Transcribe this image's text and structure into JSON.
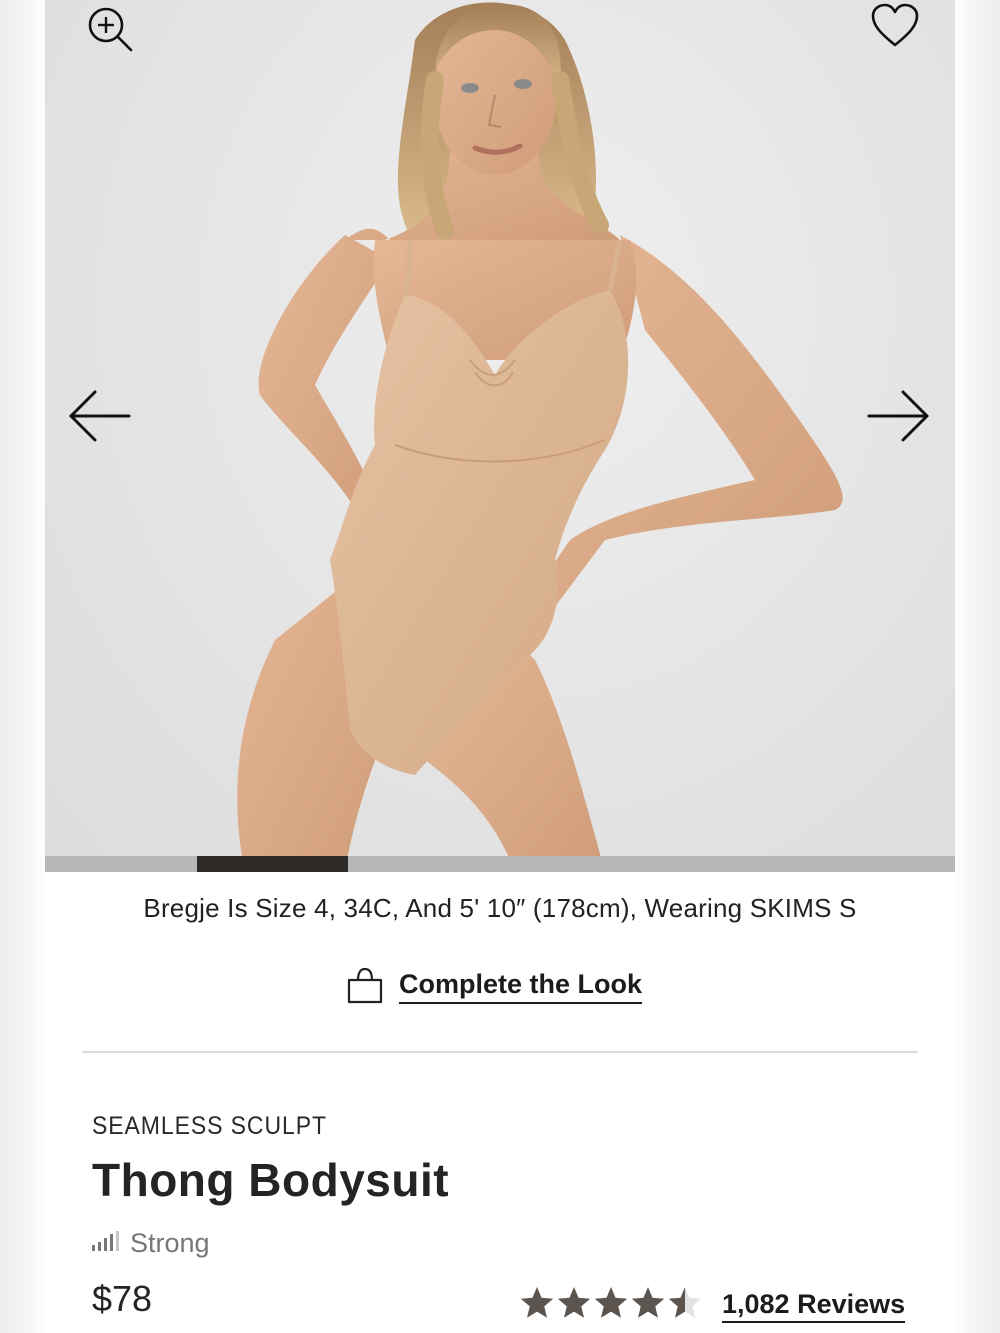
{
  "hero": {
    "icons": {
      "zoom": "zoom-in-icon",
      "favorite": "heart-icon",
      "prev": "arrow-left-icon",
      "next": "arrow-right-icon"
    },
    "progress": {
      "current_index": 2,
      "total": 6
    }
  },
  "caption": "Bregje Is Size 4, 34C, And 5' 10″ (178cm), Wearing SKIMS S",
  "complete_the_look": {
    "label": "Complete the Look",
    "icon": "shopping-bag-icon"
  },
  "product": {
    "collection": "SEAMLESS SCULPT",
    "title": "Thong Bodysuit",
    "compression": "Strong",
    "price": "$78",
    "rating": 4.5,
    "reviews_label": "1,082 Reviews"
  },
  "colors": {
    "star": "#5c554f",
    "progress_track": "#b7b7b7",
    "progress_fill": "#2e2a27",
    "text": "#242424"
  }
}
